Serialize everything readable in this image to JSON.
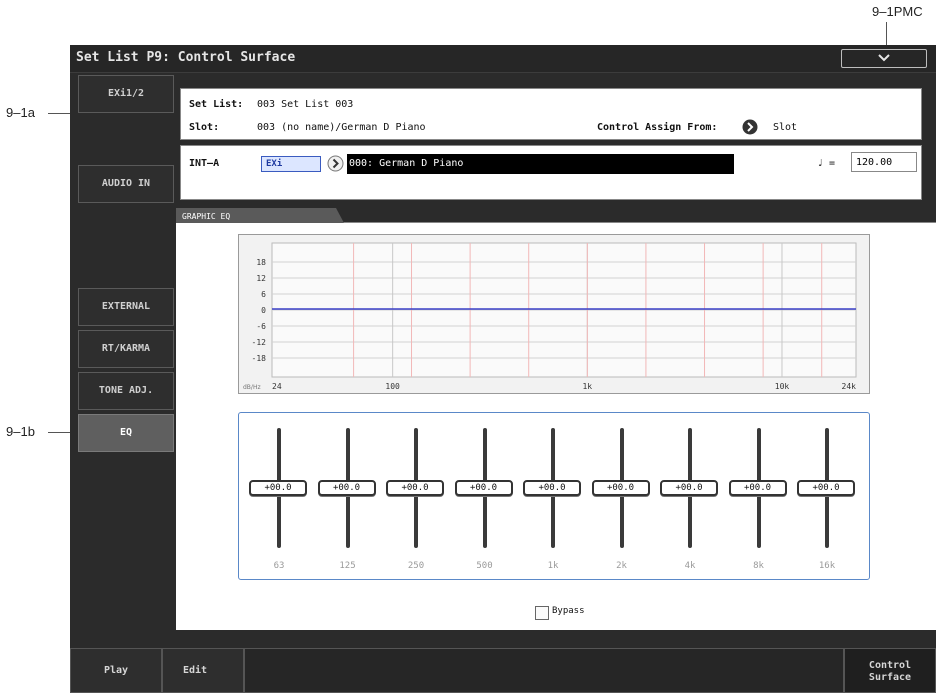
{
  "callouts": {
    "pmc": "9–1PMC",
    "a": "9–1a",
    "b": "9–1b"
  },
  "screen": {
    "title": "Set List P9: Control Surface",
    "side_tabs": [
      "EXi1/2",
      "AUDIO IN",
      "EXTERNAL",
      "RT/KARMA",
      "TONE ADJ.",
      "EQ"
    ],
    "active_side_tab": "EQ",
    "info": {
      "set_list_label": "Set List:",
      "set_list_value": "003 Set List 003",
      "slot_label": "Slot:",
      "slot_value": "003 (no name)/German D Piano",
      "control_assign_label": "Control Assign From:",
      "control_assign_value": "Slot"
    },
    "program": {
      "bank": "INT–A",
      "type": "EXi",
      "name": "000: German D Piano",
      "tempo_symbol": "♩ =",
      "tempo": "120.00"
    },
    "eq_tab_label": "GRAPHIC EQ",
    "graph": {
      "y_ticks": [
        "18",
        "12",
        "6",
        "0",
        "-6",
        "-12",
        "-18"
      ],
      "x_ticks": [
        "24",
        "100",
        "1k",
        "10k",
        "24k"
      ],
      "unit": "dB/Hz"
    },
    "bands": [
      {
        "freq": "63",
        "gain": "+00.0"
      },
      {
        "freq": "125",
        "gain": "+00.0"
      },
      {
        "freq": "250",
        "gain": "+00.0"
      },
      {
        "freq": "500",
        "gain": "+00.0"
      },
      {
        "freq": "1k",
        "gain": "+00.0"
      },
      {
        "freq": "2k",
        "gain": "+00.0"
      },
      {
        "freq": "4k",
        "gain": "+00.0"
      },
      {
        "freq": "8k",
        "gain": "+00.0"
      },
      {
        "freq": "16k",
        "gain": "+00.0"
      }
    ],
    "bypass_label": "Bypass",
    "bypass_checked": false,
    "bottom_tabs": [
      "Play",
      "Edit",
      "Control Surface"
    ],
    "colors": {
      "eq_curve": "#3b3fc8",
      "band_lines": "#f2b8b8",
      "fader_box_border": "#5a88c8"
    }
  }
}
